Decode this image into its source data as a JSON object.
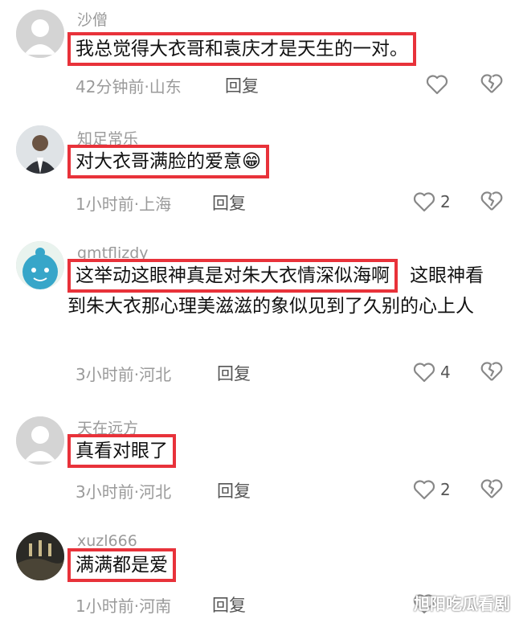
{
  "comments": [
    {
      "username": "沙僧",
      "highlight": "我总觉得大衣哥和袁庆才是天生的一对。",
      "rest": "",
      "time": "42分钟前·山东",
      "reply": "回复",
      "likes": ""
    },
    {
      "username": "知足常乐",
      "highlight": "对大衣哥满脸的爱意😁",
      "rest": "",
      "time": "1小时前·上海",
      "reply": "回复",
      "likes": "2"
    },
    {
      "username": "gmtflizdy",
      "highlight": "这举动这眼神真是对朱大衣情深似海啊",
      "rest": "这眼神看到朱大衣那心理美滋滋的象似见到了久别的心上人",
      "time": "3小时前·河北",
      "reply": "回复",
      "likes": "4"
    },
    {
      "username": "天在远方",
      "highlight": "真看对眼了",
      "rest": "",
      "time": "3小时前·河北",
      "reply": "回复",
      "likes": "2"
    },
    {
      "username": "xuzl666",
      "highlight": "满满都是爱",
      "rest": "",
      "time": "1小时前·河南",
      "reply": "回复",
      "likes": ""
    }
  ],
  "watermark": "旭阳吃瓜看剧",
  "icons": {
    "like": "heart-outline-icon",
    "dislike": "broken-heart-icon"
  },
  "colors": {
    "highlight_border": "#e8323a",
    "meta_text": "#9a9a9a"
  }
}
